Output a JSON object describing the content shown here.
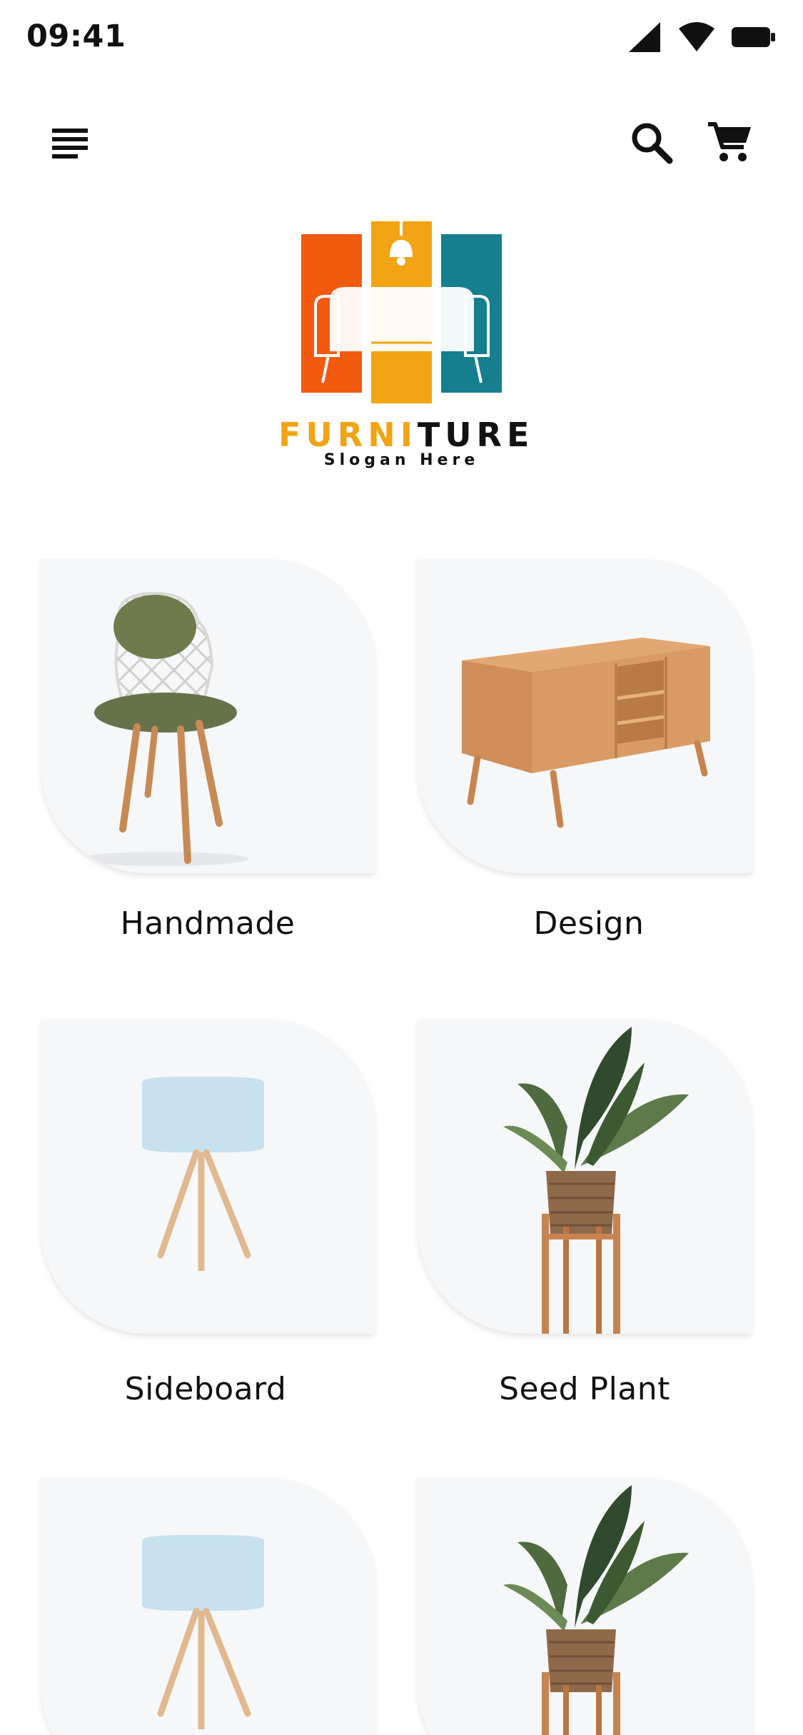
{
  "status_bar": {
    "time": "09:41",
    "icons": [
      "signal-icon",
      "wifi-icon",
      "battery-icon"
    ]
  },
  "app_bar": {
    "icons": [
      "menu-icon",
      "search-icon",
      "cart-icon"
    ]
  },
  "logo": {
    "name_highlight": "FURNI",
    "name_rest": "TURE",
    "slogan": "Slogan Here",
    "colors": {
      "orange": "#f25a10",
      "amber": "#f2a414",
      "teal": "#157f8f",
      "text": "#111111"
    }
  },
  "categories": [
    {
      "label": "Handmade",
      "image": "green-wire-chair"
    },
    {
      "label": "Design",
      "image": "wooden-tv-cabinet"
    },
    {
      "label": "Sideboard",
      "image": "blue-table-lamp"
    },
    {
      "label": "Seed Plant",
      "image": "potted-monstera-plant"
    },
    {
      "label": "",
      "image": "blue-table-lamp"
    },
    {
      "label": "",
      "image": "potted-monstera-plant"
    }
  ],
  "theme": {
    "background": "#ffffff",
    "card": "#f6f7f9",
    "text": "#111111"
  }
}
